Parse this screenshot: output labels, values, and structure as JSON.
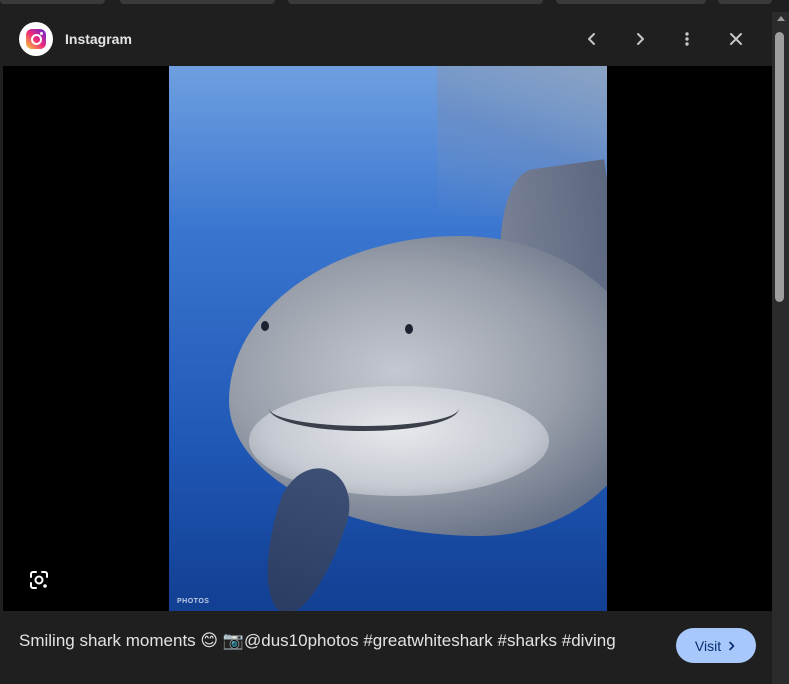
{
  "header": {
    "site_name": "Instagram",
    "logo_icon": "instagram-logo-icon",
    "buttons": {
      "prev": "chevron-left-icon",
      "next": "chevron-right-icon",
      "more": "more-vert-icon",
      "close": "close-icon"
    }
  },
  "image": {
    "watermark": "PHOTOS",
    "lens_icon": "google-lens-icon"
  },
  "caption": {
    "text": "Smiling shark moments 😊 📷@dus10photos #greatwhiteshark #sharks #diving"
  },
  "visit_button": {
    "label": "Visit",
    "icon": "chevron-right-icon"
  },
  "colors": {
    "panel_bg": "#1f1f1f",
    "viewer_bg": "#000000",
    "visit_bg": "#a8c7fa",
    "visit_text": "#062e6f",
    "text_primary": "#e3e3e3"
  }
}
